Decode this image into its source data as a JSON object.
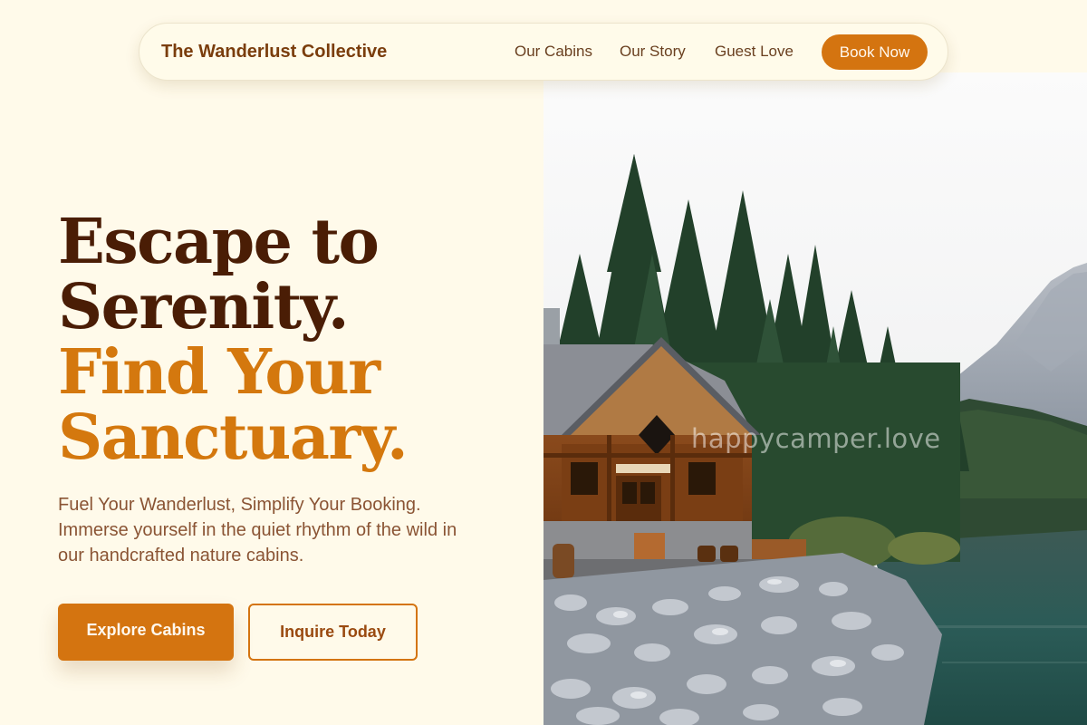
{
  "nav": {
    "brand": "The Wanderlust Collective",
    "links": [
      "Our Cabins",
      "Our Story",
      "Guest Love"
    ],
    "cta": "Book Now"
  },
  "hero": {
    "headline_line1": "Escape to",
    "headline_line2": "Serenity.",
    "headline_line3": "Find Your",
    "headline_line4": "Sanctuary.",
    "subtitle": "Fuel Your Wanderlust, Simplify Your Booking. Immerse yourself in the quiet rhythm of the wild in our handcrafted nature cabins.",
    "primary_button": "Explore Cabins",
    "secondary_button": "Inquire Today"
  },
  "photo": {
    "watermark": "happycamper.love",
    "subject": "lakeside log cabin with pine forest and mountains"
  },
  "colors": {
    "background": "#fffaea",
    "accent": "#d47410",
    "headline_dark": "#4a1d05",
    "headline_accent": "#d4780e",
    "body_text": "#8a5434"
  }
}
